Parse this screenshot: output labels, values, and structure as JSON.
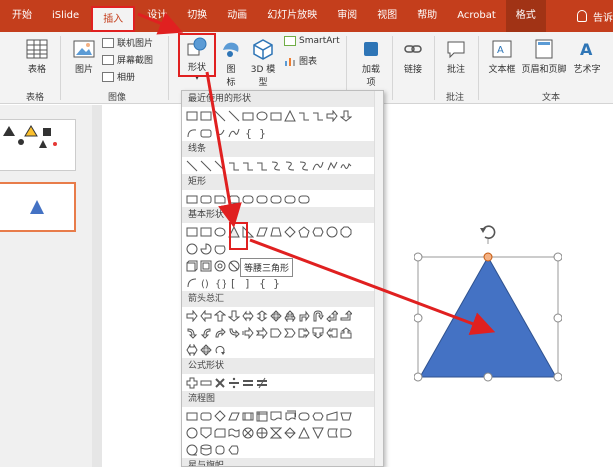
{
  "tabs": [
    {
      "label": "开始"
    },
    {
      "label": "iSlide"
    },
    {
      "label": "插入"
    },
    {
      "label": "设计"
    },
    {
      "label": "切换"
    },
    {
      "label": "动画"
    },
    {
      "label": "幻灯片放映"
    },
    {
      "label": "审阅"
    },
    {
      "label": "视图"
    },
    {
      "label": "帮助"
    },
    {
      "label": "Acrobat"
    },
    {
      "label": "格式"
    }
  ],
  "tell_me": "告诉",
  "ribbon": {
    "table_label": "表格",
    "table_group": "表格",
    "picture_label": "图片",
    "online_pictures": "联机图片",
    "screenshot": "屏幕截图",
    "album": "相册",
    "image_group": "图像",
    "shapes_label": "形状",
    "icons_label": "图标",
    "model3d_label": "3D 模型",
    "smartart": "SmartArt",
    "chart": "图表",
    "addins_label": "加载项",
    "link_label": "链接",
    "comment_label": "批注",
    "comment_group": "批注",
    "textbox_label": "文本框",
    "header_footer_label": "页眉和页脚",
    "wordart_label": "艺术字",
    "text_group": "文本"
  },
  "dropdown": {
    "recent": "最近使用的形状",
    "lines": "线条",
    "rect": "矩形",
    "basic": "基本形状",
    "arrows": "箭头总汇",
    "equation": "公式形状",
    "flowchart": "流程图",
    "stars": "星与旗帜"
  },
  "tooltip": "等腰三角形",
  "colors": {
    "brand": "#c43e1c",
    "shape_fill": "#4472c4",
    "highlight": "#e02020"
  }
}
